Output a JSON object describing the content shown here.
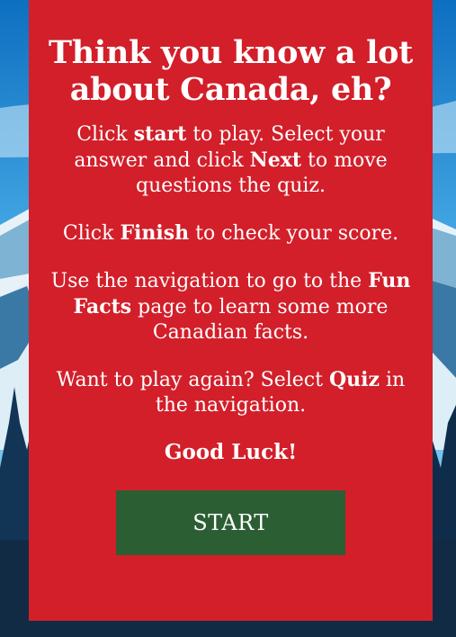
{
  "intro": {
    "title": "Think you know a lot about Canada, eh?",
    "p1": {
      "t1": "Click ",
      "b1": "start",
      "t2": " to play. Select your answer and click ",
      "b2": "Next",
      "t3": " to move questions the quiz."
    },
    "p2": {
      "t1": "Click ",
      "b1": "Finish",
      "t2": " to check your score."
    },
    "p3": {
      "t1": "Use the navigation to go to the ",
      "b1": "Fun Facts",
      "t2": " page to learn some more Canadian facts."
    },
    "p4": {
      "t1": "Want to play again? Select ",
      "b1": "Quiz",
      "t2": " in the navigation."
    },
    "good_luck": "Good Luck!",
    "start_label": "START"
  },
  "colors": {
    "card": "#d21f2a",
    "button": "#2c5e34",
    "sky": "#1d8fd8",
    "mountain_dark": "#123556"
  }
}
